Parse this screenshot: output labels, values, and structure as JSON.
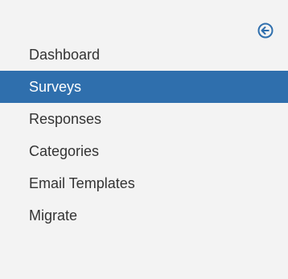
{
  "sidebar": {
    "collapse_icon": "circle-arrow-left-icon",
    "accent_color": "#2f6fad",
    "items": [
      {
        "label": "Dashboard",
        "active": false
      },
      {
        "label": "Surveys",
        "active": true
      },
      {
        "label": "Responses",
        "active": false
      },
      {
        "label": "Categories",
        "active": false
      },
      {
        "label": "Email Templates",
        "active": false
      },
      {
        "label": "Migrate",
        "active": false
      }
    ]
  }
}
